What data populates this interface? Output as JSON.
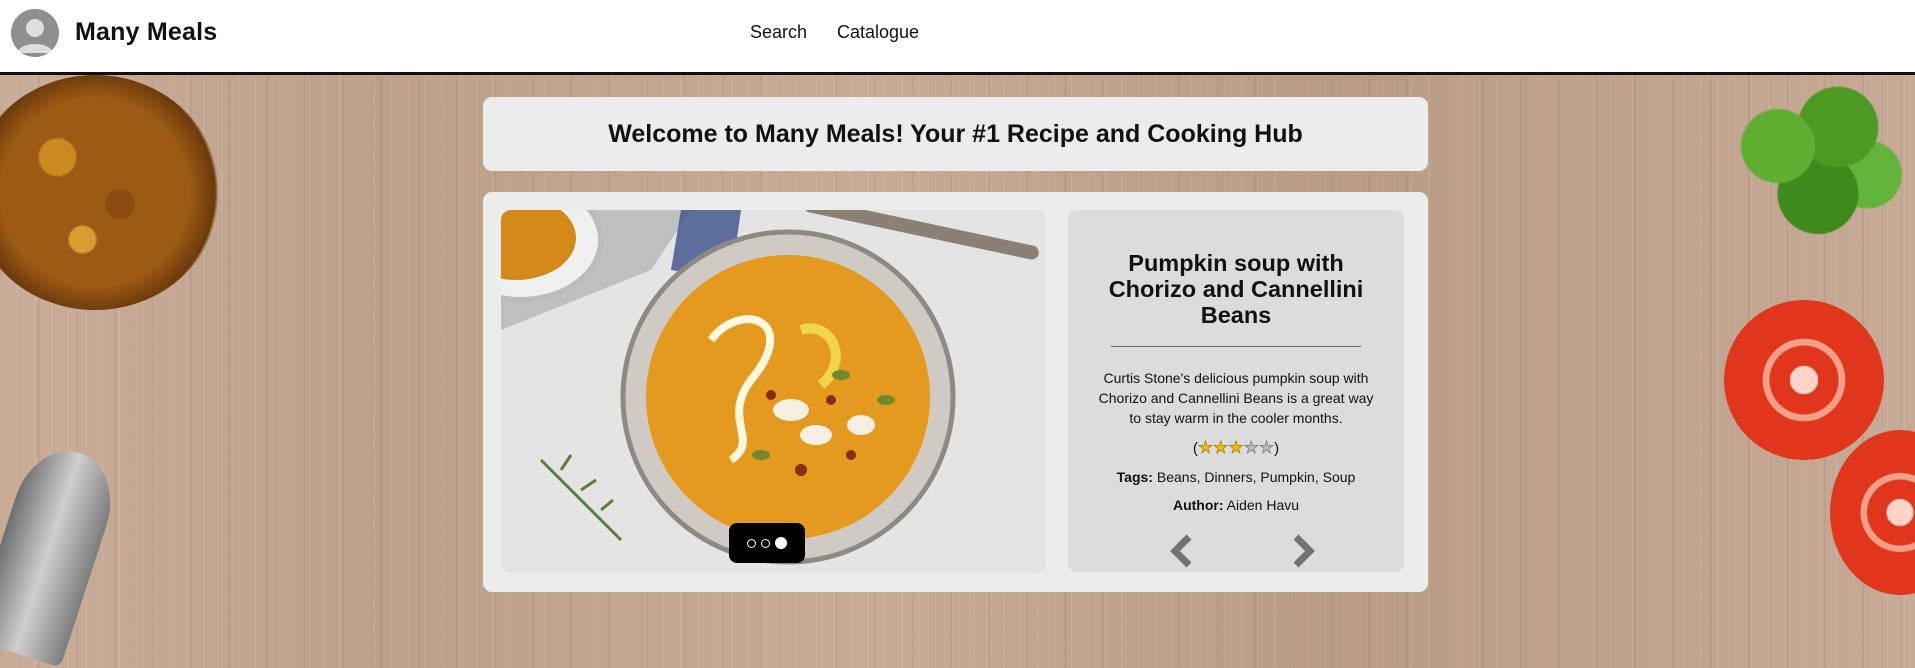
{
  "app": {
    "name": "Many Meals"
  },
  "nav": {
    "search": "Search",
    "catalogue": "Catalogue"
  },
  "welcome": {
    "text": "Welcome to Many Meals! Your #1 Recipe and Cooking Hub"
  },
  "recipe": {
    "title": "Pumpkin soup with Chorizo and Cannellini Beans",
    "description": "Curtis Stone's delicious pumpkin soup with Chorizo and Cannellini Beans is a great way to stay warm in the cooler months.",
    "rating": {
      "value": 3,
      "max": 5,
      "open": "(",
      "close": ")"
    },
    "tags_label": "Tags:",
    "tags": "Beans, Dinners, Pumpkin, Soup",
    "author_label": "Author:",
    "author": "Aiden Havu"
  },
  "carousel": {
    "slide_count": 3,
    "active_slide": 3
  },
  "colors": {
    "accent_star": "#f3b800",
    "panel": "#ececec",
    "info_panel": "#dcdcdc"
  },
  "icons": {
    "avatar": "user-avatar-icon",
    "prev": "chevron-left-icon",
    "next": "chevron-right-icon"
  }
}
